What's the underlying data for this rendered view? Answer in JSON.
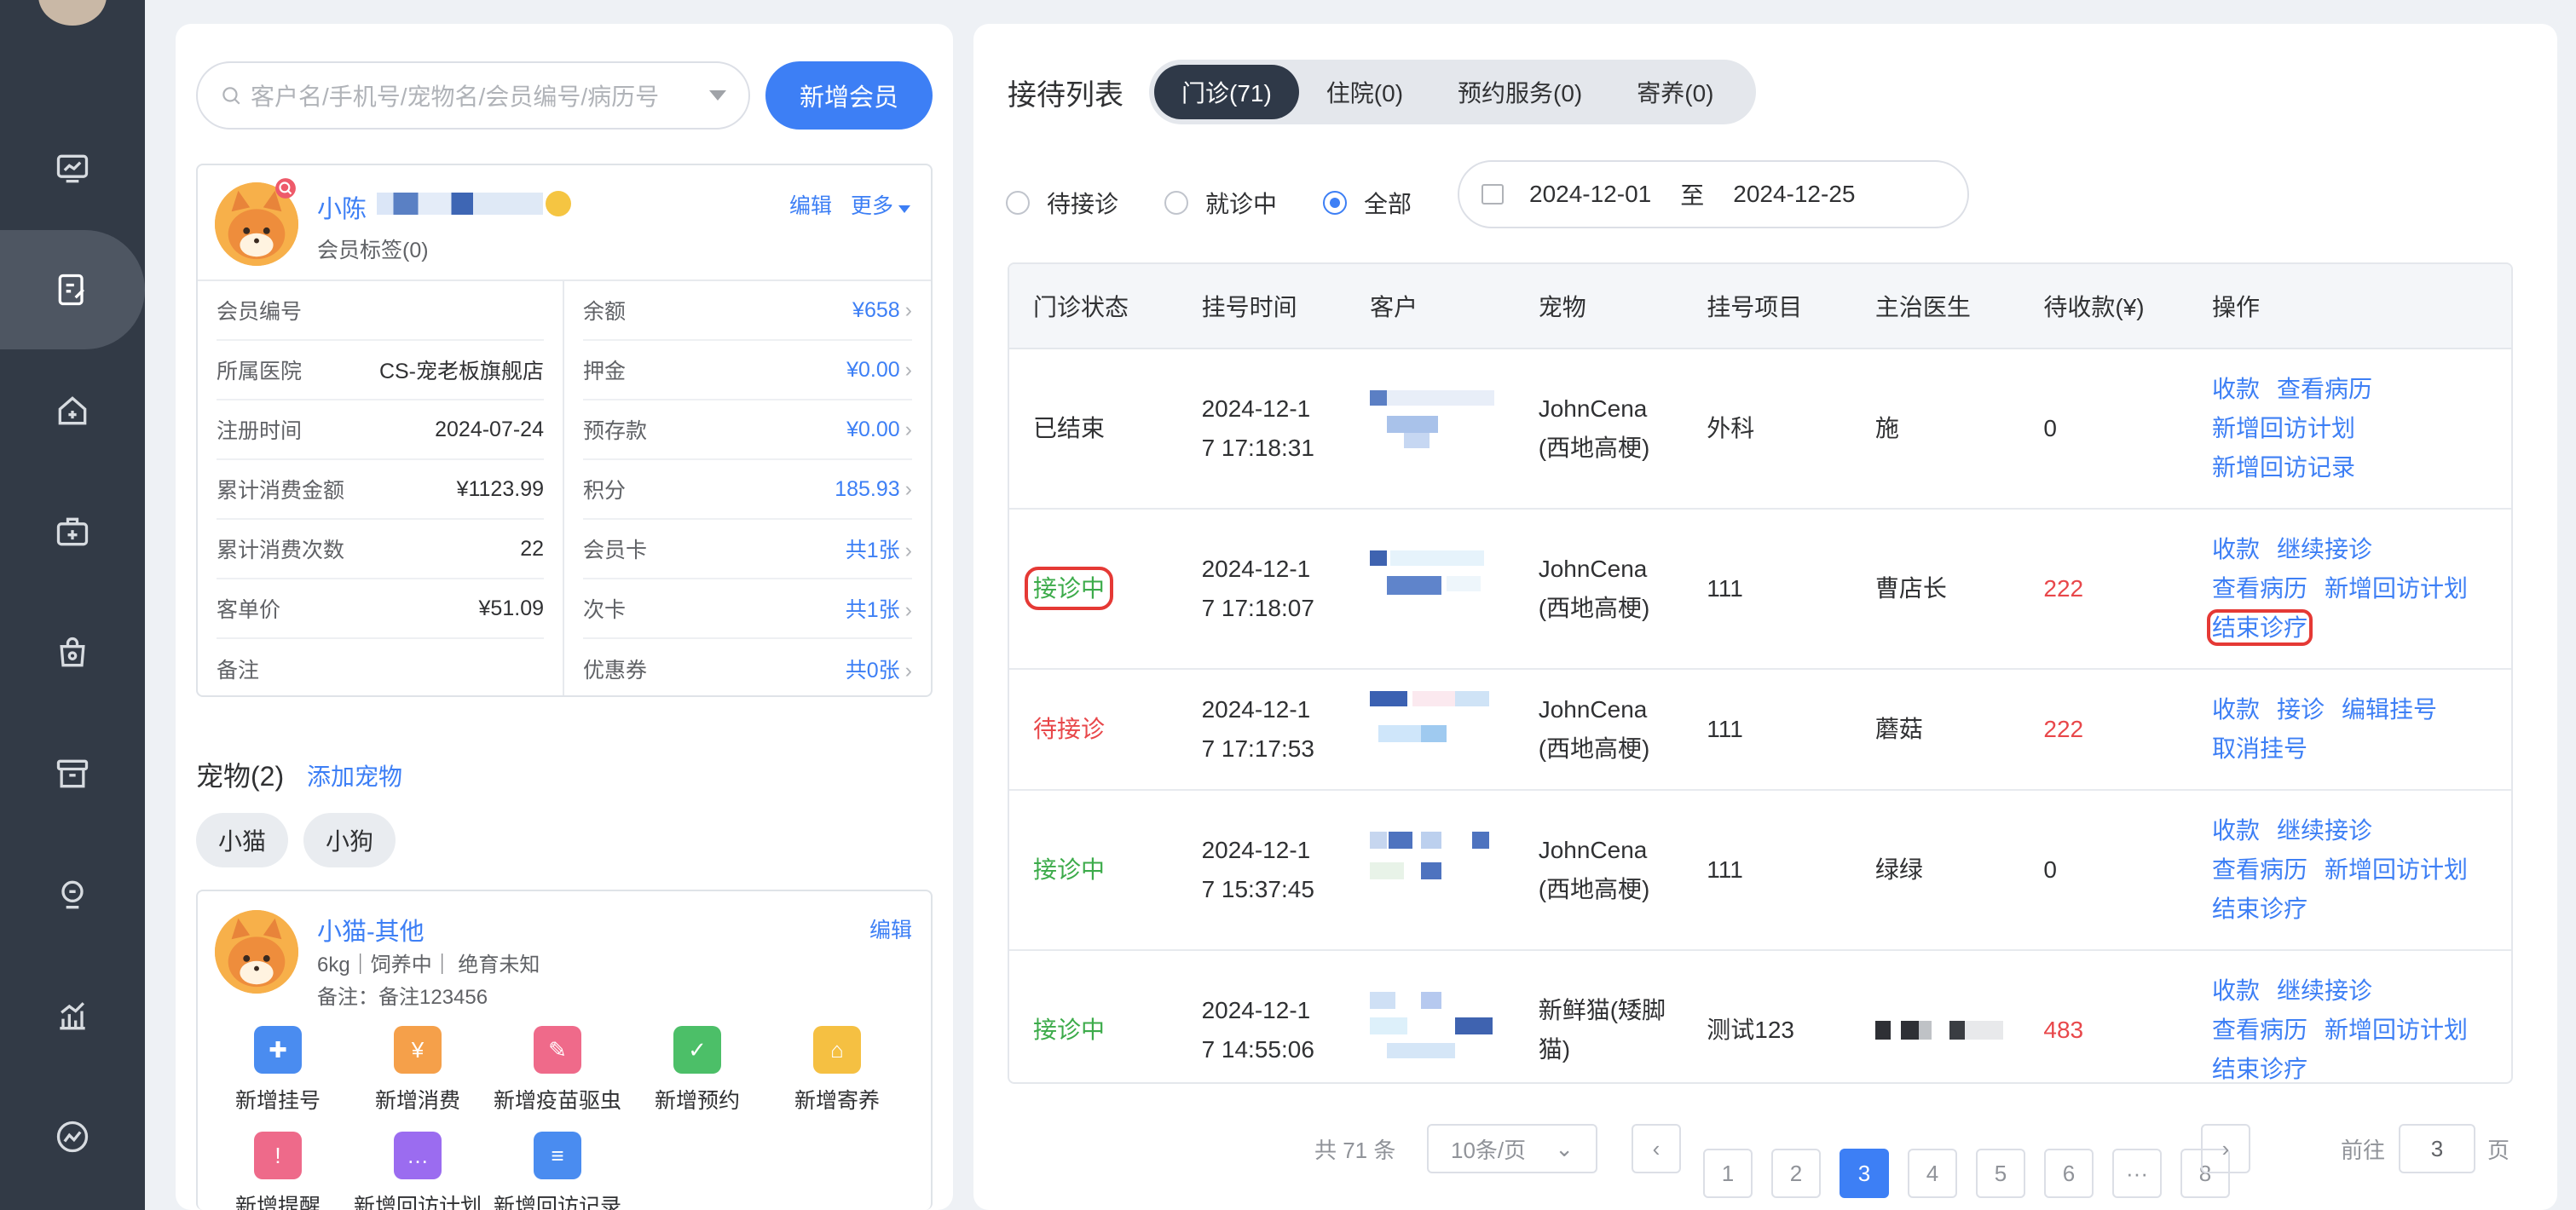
{
  "sidebar": {
    "items": [
      {
        "icon": "dashboard-icon"
      },
      {
        "icon": "reception-icon",
        "active": true
      },
      {
        "icon": "hospital-icon"
      },
      {
        "icon": "medical-kit-icon"
      },
      {
        "icon": "shopping-bag-icon"
      },
      {
        "icon": "inventory-icon"
      },
      {
        "icon": "staff-icon"
      },
      {
        "icon": "report-chart-icon"
      },
      {
        "icon": "trend-icon"
      }
    ]
  },
  "left": {
    "search_placeholder": "客户名/手机号/宠物名/会员编号/病历号",
    "add_member": "新增会员",
    "member": {
      "name": "小陈",
      "tags": "会员标签(0)",
      "edit": "编辑",
      "more": "更多",
      "left_rows": [
        {
          "k": "会员编号",
          "v": ""
        },
        {
          "k": "所属医院",
          "v": "CS-宠老板旗舰店"
        },
        {
          "k": "注册时间",
          "v": "2024-07-24"
        },
        {
          "k": "累计消费金额",
          "v": "¥1123.99"
        },
        {
          "k": "累计消费次数",
          "v": "22"
        },
        {
          "k": "客单价",
          "v": "¥51.09"
        },
        {
          "k": "备注",
          "v": ""
        }
      ],
      "right_rows": [
        {
          "k": "余额",
          "v": "¥658"
        },
        {
          "k": "押金",
          "v": "¥0.00"
        },
        {
          "k": "预存款",
          "v": "¥0.00"
        },
        {
          "k": "积分",
          "v": "185.93"
        },
        {
          "k": "会员卡",
          "v": "共1张"
        },
        {
          "k": "次卡",
          "v": "共1张"
        },
        {
          "k": "优惠券",
          "v": "共0张"
        }
      ]
    },
    "pets_title": "宠物(2)",
    "add_pet": "添加宠物",
    "pet_tabs": [
      "小猫",
      "小狗"
    ],
    "pet": {
      "name": "小猫-其他",
      "edit": "编辑",
      "meta": "6kg｜饲养中｜ 绝育未知",
      "note": "备注：备注123456"
    },
    "quick_actions": [
      {
        "label": "新增挂号",
        "icon": "register-icon",
        "color": "#4a8cf0"
      },
      {
        "label": "新增消费",
        "icon": "yuan-icon",
        "color": "#f5a04a"
      },
      {
        "label": "新增疫苗驱虫",
        "icon": "syringe-icon",
        "color": "#ef6a8a"
      },
      {
        "label": "新增预约",
        "icon": "calendar-check-icon",
        "color": "#4cbf68"
      },
      {
        "label": "新增寄养",
        "icon": "house-icon",
        "color": "#f5c042"
      },
      {
        "label": "新增提醒",
        "icon": "bell-icon",
        "color": "#ee6a8a"
      },
      {
        "label": "新增回访计划",
        "icon": "chat-icon",
        "color": "#9b6cf0"
      },
      {
        "label": "新增回访记录",
        "icon": "clipboard-icon",
        "color": "#4a8cf0"
      }
    ]
  },
  "right": {
    "title": "接待列表",
    "tabs": [
      "门诊(71)",
      "住院(0)",
      "预约服务(0)",
      "寄养(0)"
    ],
    "filters": [
      "待接诊",
      "就诊中",
      "全部"
    ],
    "date_from": "2024-12-01",
    "date_to_label": "至",
    "date_to": "2024-12-25",
    "columns": [
      "门诊状态",
      "挂号时间",
      "客户",
      "宠物",
      "挂号项目",
      "主治医生",
      "待收款(¥)",
      "操作"
    ],
    "rows": [
      {
        "status": "已结束",
        "time1": "2024-12-1",
        "time2": "7 17:18:31",
        "pet1": "JohnCena",
        "pet2": "(西地高梗)",
        "item": "外科",
        "doctor": "施",
        "amount": "0",
        "ops": [
          [
            "收款",
            "查看病历"
          ],
          [
            "新增回访计划"
          ],
          [
            "新增回访记录"
          ]
        ]
      },
      {
        "status": "接诊中",
        "time1": "2024-12-1",
        "time2": "7 17:18:07",
        "pet1": "JohnCena",
        "pet2": "(西地高梗)",
        "item": "111",
        "doctor": "曹店长",
        "amount": "222",
        "ops": [
          [
            "收款",
            "继续接诊"
          ],
          [
            "查看病历",
            "新增回访计划"
          ],
          [
            "结束诊疗"
          ]
        ]
      },
      {
        "status": "待接诊",
        "time1": "2024-12-1",
        "time2": "7 17:17:53",
        "pet1": "JohnCena",
        "pet2": "(西地高梗)",
        "item": "111",
        "doctor": "蘑菇",
        "amount": "222",
        "ops": [
          [
            "收款",
            "接诊",
            "编辑挂号"
          ],
          [
            "取消挂号"
          ]
        ]
      },
      {
        "status": "接诊中",
        "time1": "2024-12-1",
        "time2": "7 15:37:45",
        "pet1": "JohnCena",
        "pet2": "(西地高梗)",
        "item": "111",
        "doctor": "绿绿",
        "amount": "0",
        "ops": [
          [
            "收款",
            "继续接诊"
          ],
          [
            "查看病历",
            "新增回访计划"
          ],
          [
            "结束诊疗"
          ]
        ]
      },
      {
        "status": "接诊中",
        "time1": "2024-12-1",
        "time2": "7 14:55:06",
        "pet1": "新鲜猫(矮脚",
        "pet2": "猫)",
        "item": "测试123",
        "doctor": "",
        "amount": "483",
        "ops": [
          [
            "收款",
            "继续接诊"
          ],
          [
            "查看病历",
            "新增回访计划"
          ],
          [
            "结束诊疗"
          ]
        ]
      }
    ],
    "pager": {
      "total": "共 71 条",
      "size": "10条/页",
      "pages": [
        "1",
        "2",
        "3",
        "4",
        "5",
        "6",
        "···",
        "8"
      ],
      "current": "3",
      "goto_label": "前往",
      "goto_value": "3",
      "goto_unit": "页"
    }
  }
}
